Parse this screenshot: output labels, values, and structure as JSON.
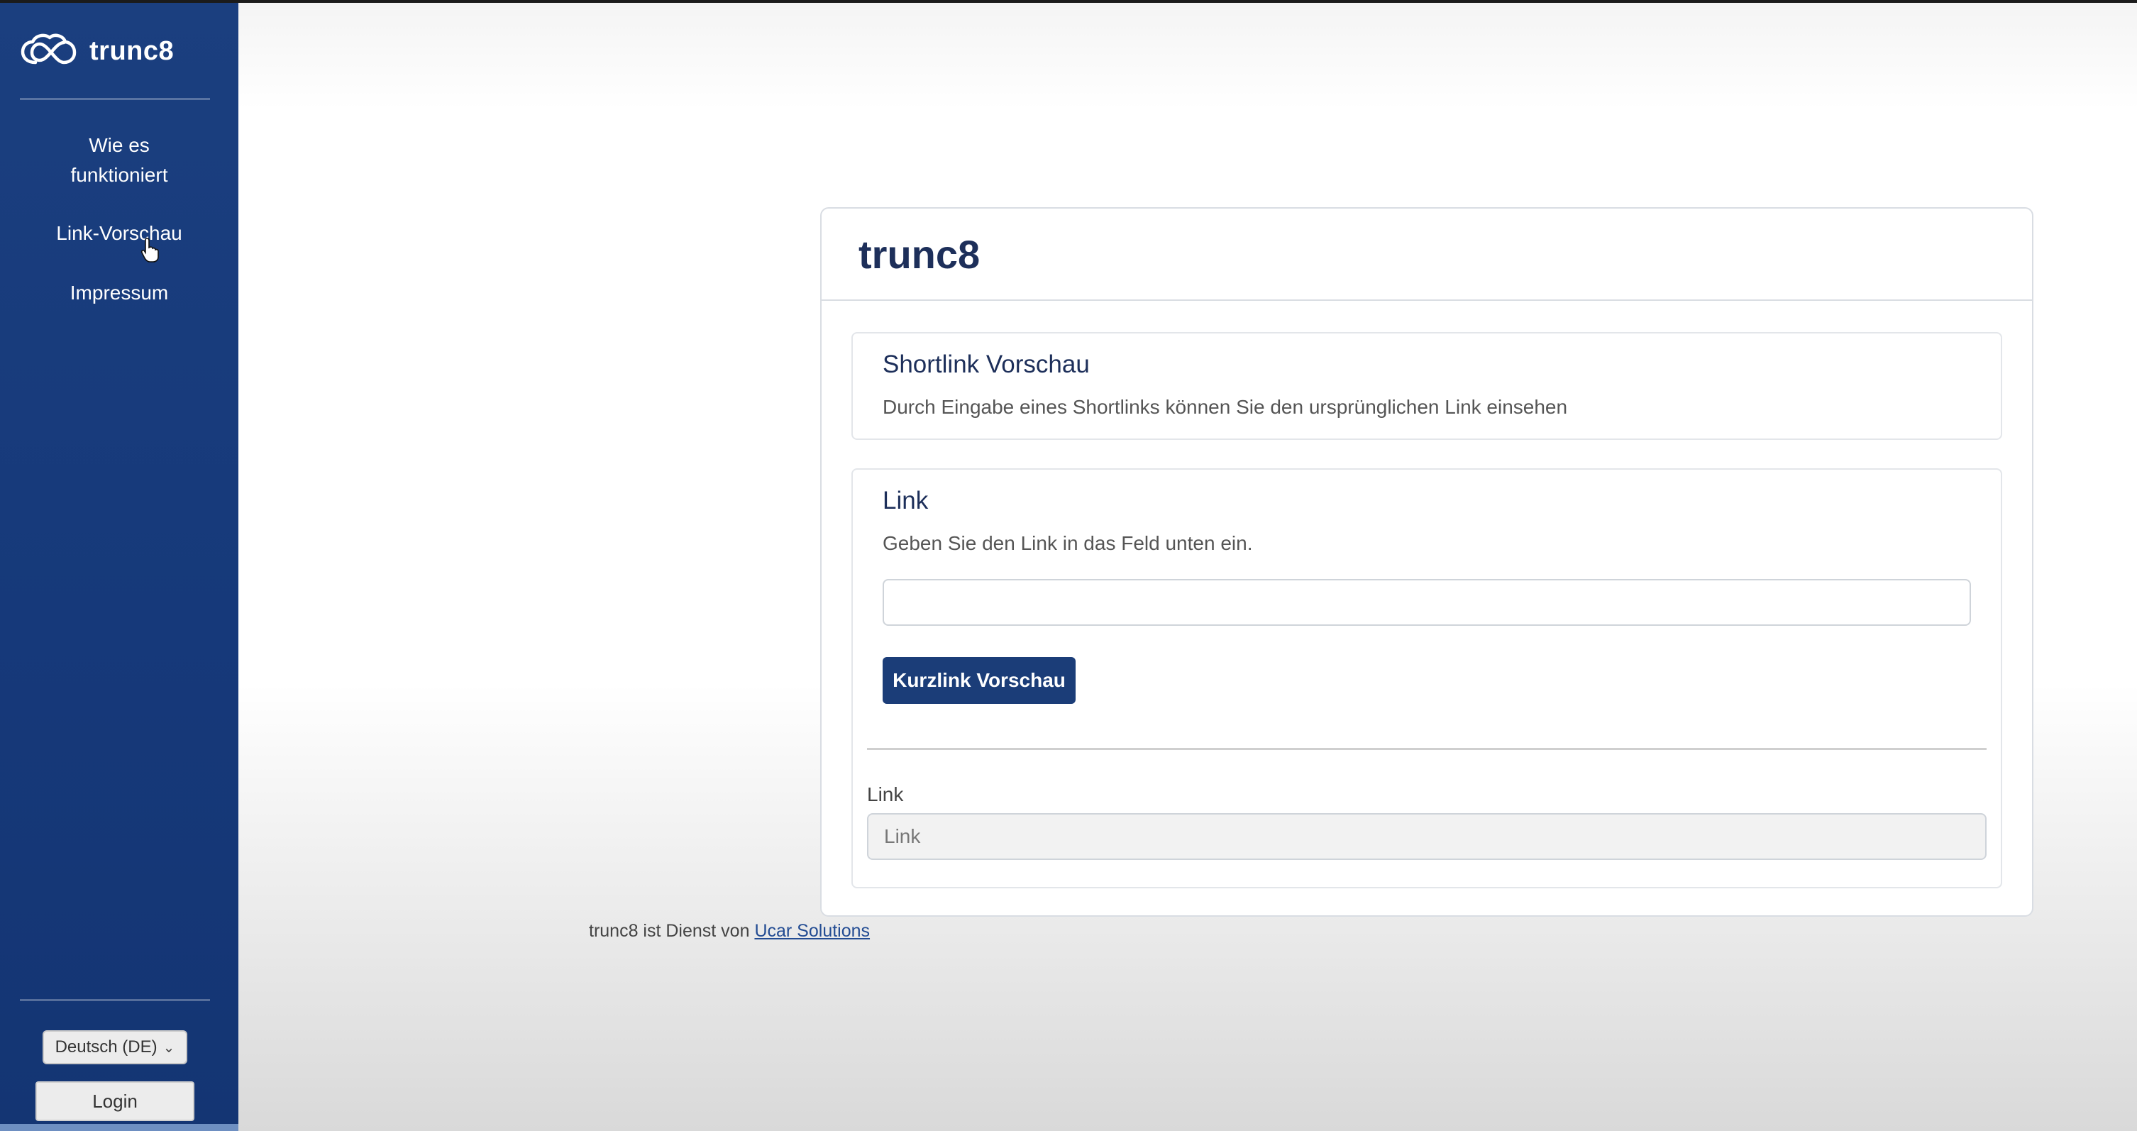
{
  "app": {
    "name": "trunc8"
  },
  "sidebar": {
    "nav": [
      {
        "label": "Wie es funktioniert"
      },
      {
        "label": "Link-Vorschau"
      },
      {
        "label": "Impressum"
      }
    ],
    "language": "Deutsch (DE)",
    "login_label": "Login"
  },
  "card": {
    "title": "trunc8",
    "preview_section": {
      "title": "Shortlink Vorschau",
      "description": "Durch Eingabe eines Shortlinks können Sie den ursprünglichen Link einsehen"
    },
    "link_section": {
      "title": "Link",
      "instruction": "Geben Sie den Link in das Feld unten ein.",
      "input_value": "",
      "button_label": "Kurzlink Vorschau",
      "result_label": "Link",
      "result_placeholder": "Link"
    }
  },
  "footer": {
    "text": "trunc8 ist Dienst von",
    "link_text": "Ucar Solutions"
  },
  "colors": {
    "sidebar_bg": "#16397a",
    "primary_button": "#1b3d78",
    "title_text": "#1d2f5a",
    "link": "#234c93"
  },
  "icons": [
    "cloud-infinity-logo-icon",
    "hand-pointer-icon",
    "chevron-down-icon"
  ]
}
